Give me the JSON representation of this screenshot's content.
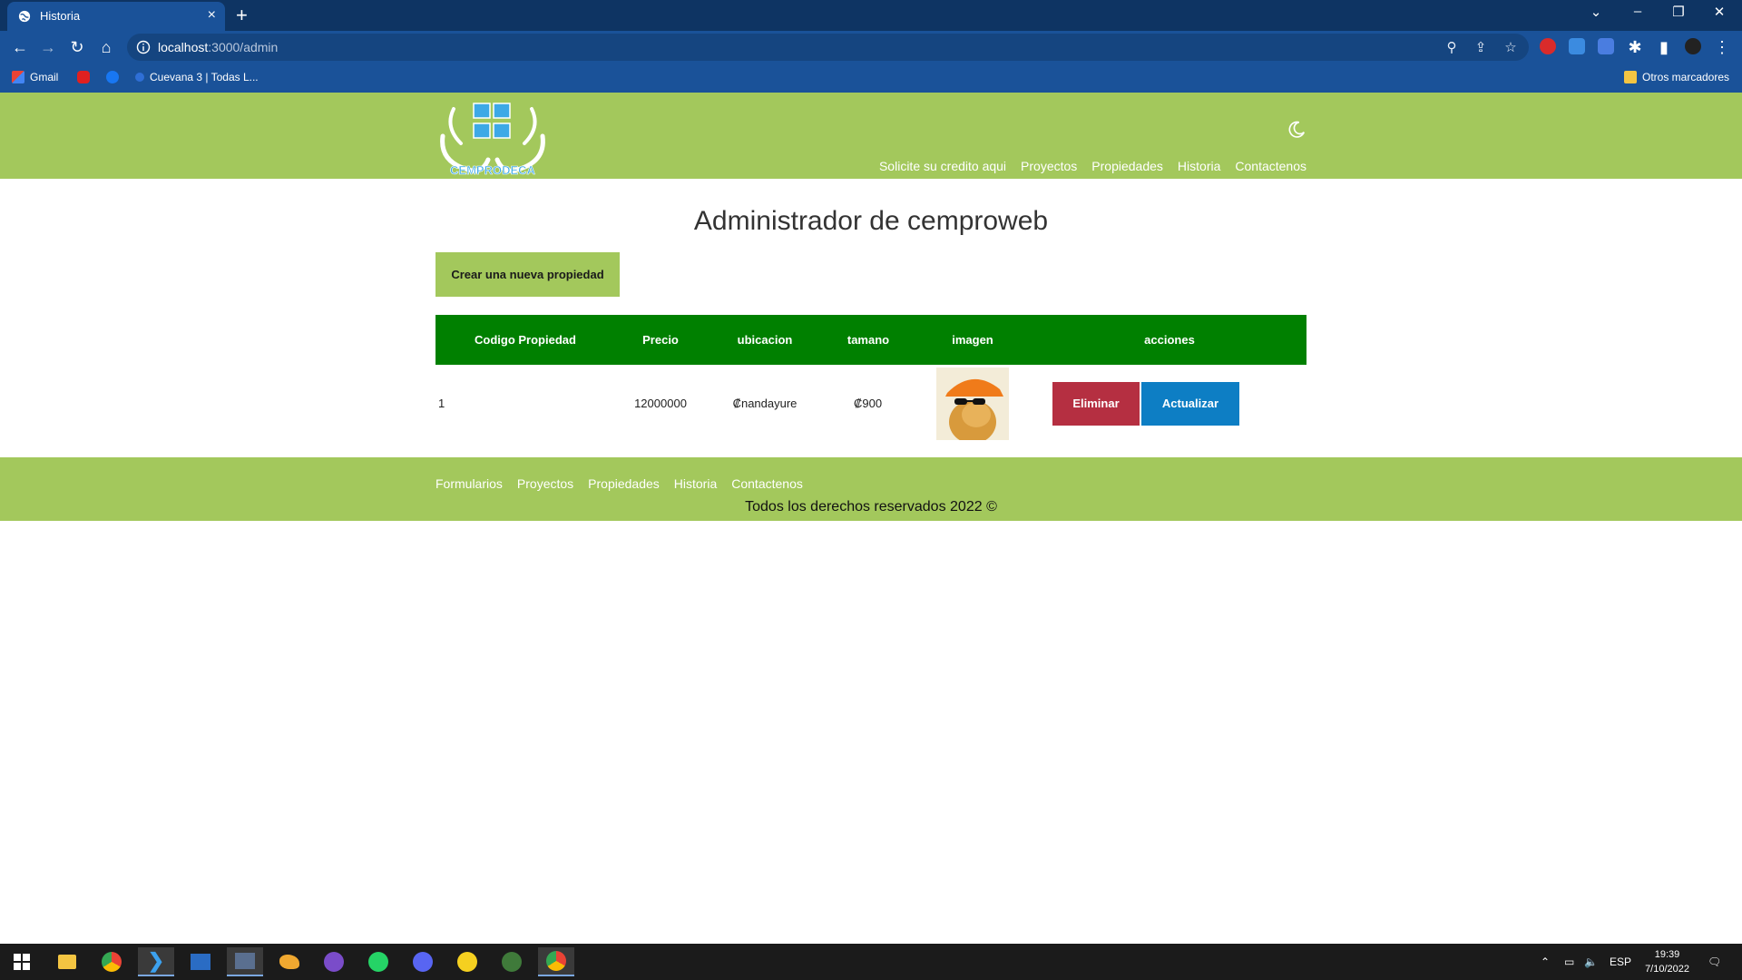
{
  "browser": {
    "tab_title": "Historia",
    "url_host": "localhost",
    "url_path": ":3000/admin",
    "bookmarks": [
      {
        "label": "Gmail"
      },
      {
        "label": ""
      },
      {
        "label": ""
      },
      {
        "label": "Cuevana 3 | Todas L..."
      }
    ],
    "other_bookmarks": "Otros marcadores"
  },
  "site": {
    "logo_text": "CEMPRODECA",
    "nav": [
      "Solicite su credito aqui",
      "Proyectos",
      "Propiedades",
      "Historia",
      "Contactenos"
    ],
    "title": "Administrador de cemproweb",
    "create_button": "Crear una nueva propiedad",
    "table": {
      "headers": [
        "Codigo Propiedad",
        "Precio",
        "ubicacion",
        "tamano",
        "imagen",
        "acciones"
      ],
      "rows": [
        {
          "codigo": "1",
          "precio": "12000000",
          "ubicacion": "₡nandayure",
          "tamano": "₡900",
          "delete_label": "Eliminar",
          "update_label": "Actualizar"
        }
      ]
    },
    "footer_nav": [
      "Formularios",
      "Proyectos",
      "Propiedades",
      "Historia",
      "Contactenos"
    ],
    "copyright": "Todos los derechos reservados 2022 ©"
  },
  "taskbar": {
    "language": "ESP",
    "time": "19:39",
    "date": "7/10/2022"
  },
  "colors": {
    "header_green": "#a3c85c",
    "table_header": "#008000",
    "delete_red": "#b52f41",
    "update_blue": "#0d7ec4",
    "chrome_blue": "#1a5299"
  }
}
